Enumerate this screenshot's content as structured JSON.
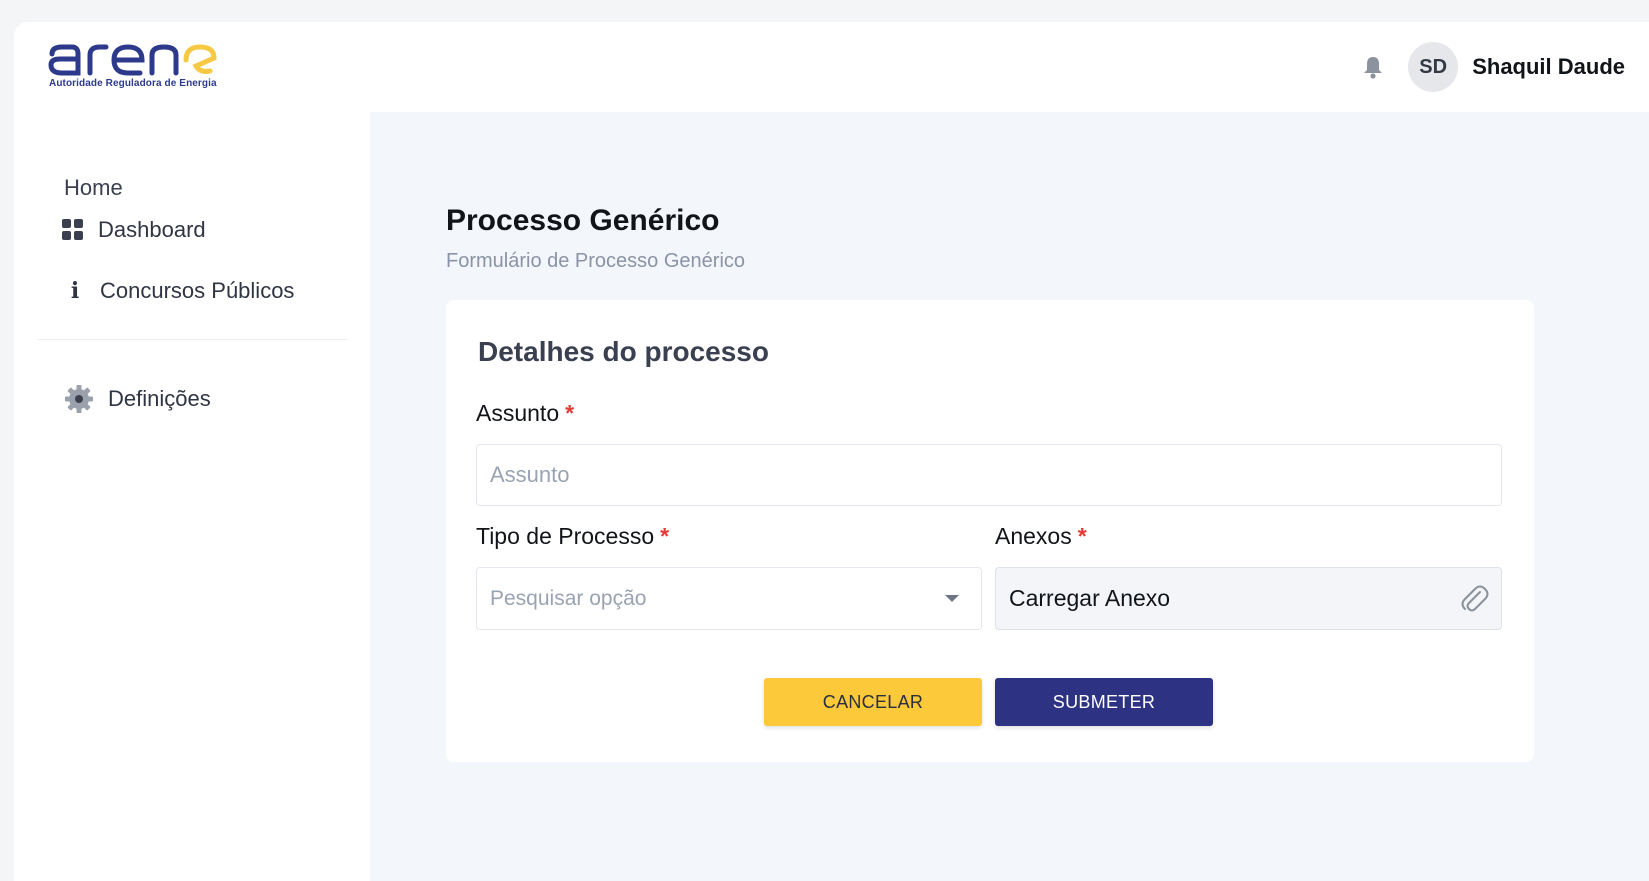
{
  "brand": {
    "name": "arene",
    "tagline": "Autoridade Reguladora de Energia",
    "colors": {
      "primary": "#2d3a8c",
      "accent": "#f6c945"
    }
  },
  "header": {
    "notification_icon": "bell-icon",
    "user": {
      "initials": "SD",
      "name": "Shaquil Daude"
    }
  },
  "sidebar": {
    "section_label": "Home",
    "items": [
      {
        "label": "Dashboard",
        "icon": "grid-icon"
      },
      {
        "label": "Concursos Públicos",
        "icon": "info-icon"
      }
    ],
    "footer_items": [
      {
        "label": "Definições",
        "icon": "gear-icon"
      }
    ]
  },
  "page": {
    "title": "Processo Genérico",
    "subtitle": "Formulário de Processo Genérico"
  },
  "form": {
    "section_title": "Detalhes do processo",
    "required_marker": "*",
    "subject": {
      "label": "Assunto",
      "placeholder": "Assunto",
      "value": ""
    },
    "process_type": {
      "label": "Tipo de Processo",
      "placeholder": "Pesquisar opção",
      "value": ""
    },
    "attachments": {
      "label": "Anexos",
      "button_label": "Carregar Anexo",
      "icon": "paperclip-icon"
    },
    "buttons": {
      "cancel": "CANCELAR",
      "submit": "SUBMETER"
    },
    "colors": {
      "cancel": "#fcc93a",
      "submit": "#2d3282",
      "required": "#e53935"
    }
  }
}
